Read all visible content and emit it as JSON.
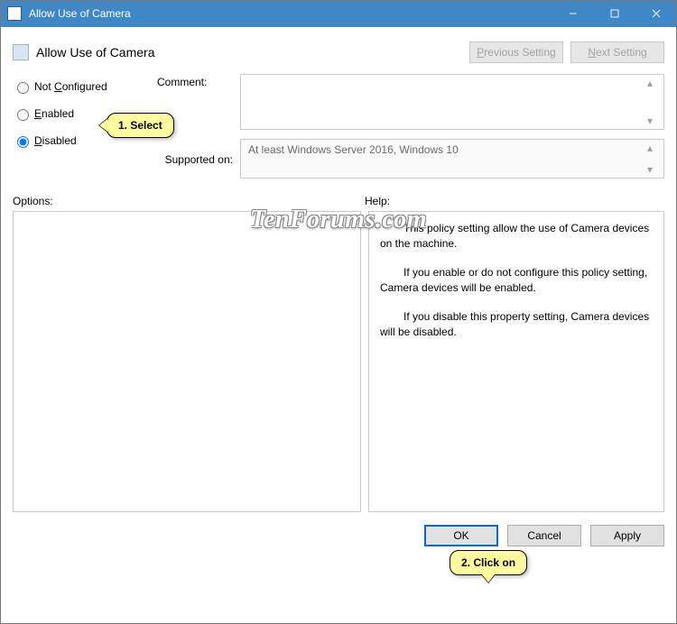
{
  "window": {
    "title": "Allow Use of Camera",
    "heading": "Allow Use of Camera"
  },
  "nav": {
    "previous": "Previous Setting",
    "next": "Next Setting"
  },
  "radios": {
    "not_configured": "Not Configured",
    "enabled": "Enabled",
    "disabled": "Disabled",
    "selected": "disabled"
  },
  "fields": {
    "comment_label": "Comment:",
    "comment_value": "",
    "supported_label": "Supported on:",
    "supported_value": "At least Windows Server 2016, Windows 10"
  },
  "panes": {
    "options_label": "Options:",
    "help_label": "Help:",
    "help_paragraphs": [
      "This policy setting allow the use of Camera devices on the machine.",
      "If you enable or do not configure this policy setting, Camera devices will be enabled.",
      "If you disable this property setting, Camera devices will be disabled."
    ]
  },
  "buttons": {
    "ok": "OK",
    "cancel": "Cancel",
    "apply": "Apply"
  },
  "annotations": {
    "step1": "1. Select",
    "step2": "2. Click on"
  },
  "watermark": "TenForums.com"
}
